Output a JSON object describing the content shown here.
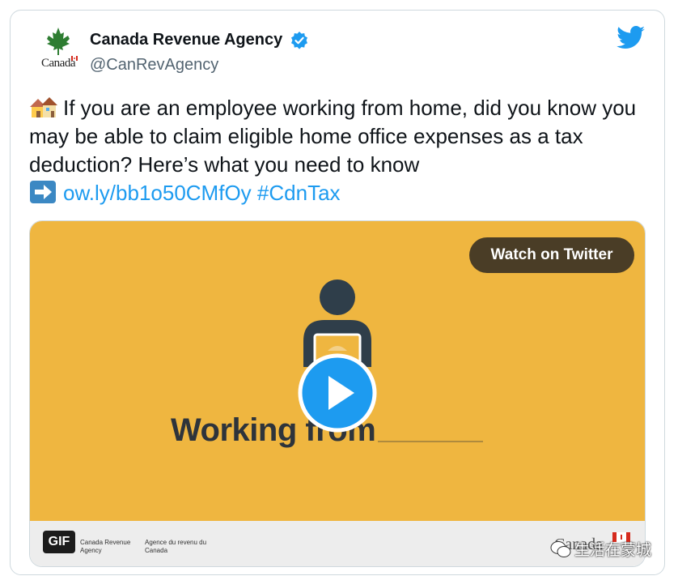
{
  "account": {
    "name": "Canada Revenue Agency",
    "handle": "@CanRevAgency",
    "logo_word": "Canada",
    "verified_icon": "verified-badge-icon"
  },
  "tweet": {
    "text": "If you are an employee working from home, did you know you may be able to claim eligible home office expenses as a tax deduction? Here’s what you need to know",
    "link": "ow.ly/bb1o50CMfOy",
    "hashtag": "#CdnTax"
  },
  "media": {
    "watch_label": "Watch on Twitter",
    "video_title": "Working from",
    "gif_label": "GIF",
    "signature_en": "Canada Revenue Agency",
    "signature_fr": "Agence du revenu du Canada",
    "footer_wordmark": "Canada"
  },
  "watermark": {
    "text": "生活在蒙城"
  },
  "colors": {
    "accent": "#1d9bf0",
    "video_bg": "#efb640",
    "watch_btn": "#4a3d26"
  }
}
